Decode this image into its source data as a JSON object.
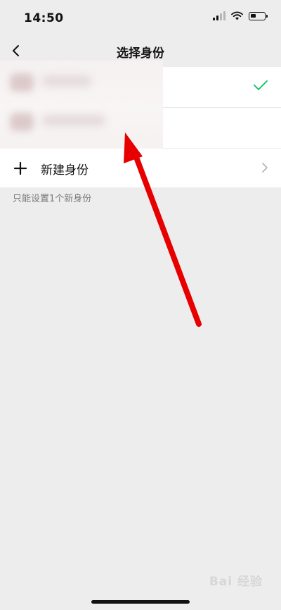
{
  "status_bar": {
    "time": "14:50"
  },
  "nav": {
    "title": "选择身份"
  },
  "identity_list": {
    "selected_index": 0
  },
  "new_identity": {
    "label": "新建身份"
  },
  "hint": "只能设置1个新身份",
  "watermark": "Bai 经验",
  "colors": {
    "background": "#ededed",
    "check": "#07c160",
    "arrow": "#e60000"
  },
  "icons": [
    "back-icon",
    "checkmark-icon",
    "plus-icon",
    "chevron-right-icon",
    "wifi-icon",
    "signal-icon",
    "battery-icon"
  ]
}
